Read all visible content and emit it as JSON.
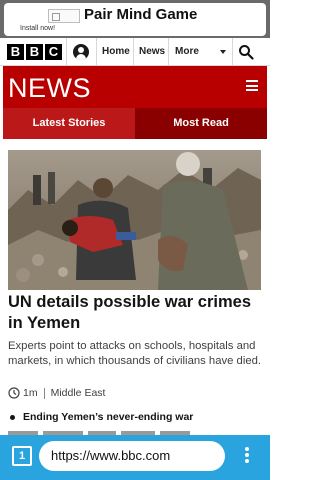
{
  "ad": {
    "title": "Pair Mind Game",
    "subtitle": "Install now!"
  },
  "nav": {
    "logo_letters": [
      "B",
      "B",
      "C"
    ],
    "links": [
      "Home",
      "News",
      "More"
    ],
    "icons": [
      "account-icon",
      "chevron-down-icon",
      "search-icon"
    ]
  },
  "header": {
    "title": "NEWS",
    "menu_icon": "hamburger-icon",
    "accent_color": "#b80000"
  },
  "tabs": [
    {
      "label": "Latest Stories"
    },
    {
      "label": "Most Read"
    }
  ],
  "article": {
    "headline": "UN details possible war crimes in Yemen",
    "summary": "Experts point to attacks on schools, hospitals and markets, in which thousands of civilians have died.",
    "time": "1m",
    "section": "Middle East"
  },
  "related": [
    {
      "label": "Ending Yemen’s never-ending war"
    }
  ],
  "browser": {
    "tab_count": "1",
    "url": "https://www.bbc.com",
    "bar_color": "#29a4de"
  }
}
